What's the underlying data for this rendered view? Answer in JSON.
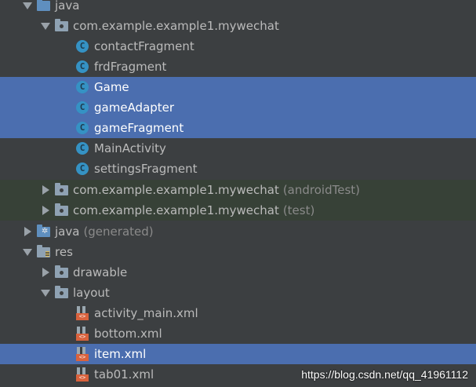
{
  "tree": {
    "rows": [
      {
        "label": "java",
        "suffix": "",
        "icon": "source-folder-icon"
      },
      {
        "label": "com.example.example1.mywechat",
        "suffix": "",
        "icon": "package-folder-icon"
      },
      {
        "label": "contactFragment",
        "suffix": "",
        "icon": "class-icon",
        "badge": "C"
      },
      {
        "label": "frdFragment",
        "suffix": "",
        "icon": "class-icon",
        "badge": "C"
      },
      {
        "label": "Game",
        "suffix": "",
        "icon": "class-icon",
        "badge": "C"
      },
      {
        "label": "gameAdapter",
        "suffix": "",
        "icon": "class-icon",
        "badge": "C"
      },
      {
        "label": "gameFragment",
        "suffix": "",
        "icon": "class-icon",
        "badge": "C"
      },
      {
        "label": "MainActivity",
        "suffix": "",
        "icon": "class-icon",
        "badge": "C"
      },
      {
        "label": "settingsFragment",
        "suffix": "",
        "icon": "class-icon",
        "badge": "C"
      },
      {
        "label": "com.example.example1.mywechat",
        "suffix": "(androidTest)",
        "icon": "package-folder-icon"
      },
      {
        "label": "com.example.example1.mywechat",
        "suffix": "(test)",
        "icon": "package-folder-icon"
      },
      {
        "label": "java",
        "suffix": "(generated)",
        "icon": "generated-folder-icon"
      },
      {
        "label": "res",
        "suffix": "",
        "icon": "resource-folder-icon"
      },
      {
        "label": "drawable",
        "suffix": "",
        "icon": "package-folder-icon"
      },
      {
        "label": "layout",
        "suffix": "",
        "icon": "package-folder-icon"
      },
      {
        "label": "activity_main.xml",
        "suffix": "",
        "icon": "layout-xml-icon",
        "badge": "<>"
      },
      {
        "label": "bottom.xml",
        "suffix": "",
        "icon": "layout-xml-icon",
        "badge": "<>"
      },
      {
        "label": "item.xml",
        "suffix": "",
        "icon": "layout-xml-icon",
        "badge": "<>"
      },
      {
        "label": "tab01.xml",
        "suffix": "",
        "icon": "layout-xml-icon",
        "badge": "<>"
      }
    ]
  },
  "watermark": "https://blog.csdn.net/qq_41961112",
  "colors": {
    "background": "#3c3f41",
    "selection": "#4b6eaf",
    "test_background": "#374137",
    "class_icon": "#3592c4",
    "xml_icon": "#d9623d"
  }
}
